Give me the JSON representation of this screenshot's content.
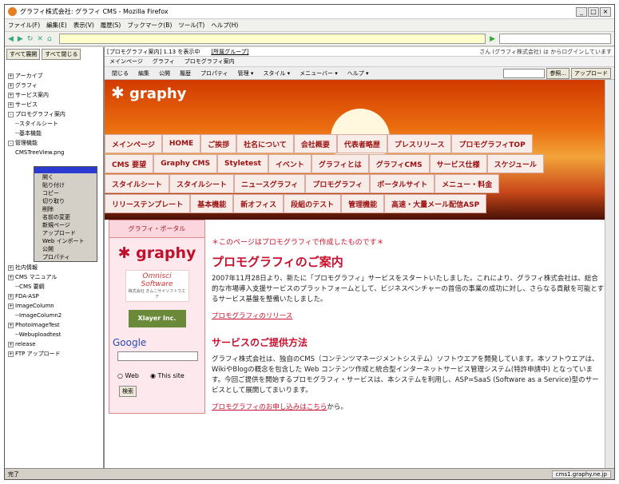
{
  "window": {
    "title": "グラフィ株式会社: グラフィ CMS - Mozilla Firefox"
  },
  "menu": [
    "ファイル(F)",
    "編集(E)",
    "表示(V)",
    "履歴(S)",
    "ブックマーク(B)",
    "ツール(T)",
    "ヘルプ(H)"
  ],
  "left": {
    "open_all": "すべて展開",
    "close_all": "すべて閉じる",
    "tree": [
      {
        "t": "アーカイブ",
        "pm": "+"
      },
      {
        "t": "グラフィ",
        "pm": "+"
      },
      {
        "t": "サービス案内",
        "pm": "+"
      },
      {
        "t": "サービス",
        "pm": "+"
      },
      {
        "t": "プロモグラフィ案内",
        "pm": "-"
      },
      {
        "t": "--スタイルシート",
        "pm": ""
      },
      {
        "t": "--基本機能",
        "pm": ""
      },
      {
        "t": "管理機能",
        "pm": "-"
      },
      {
        "t": "CMSTreeView.png",
        "pm": ""
      }
    ],
    "tree_after": [
      {
        "t": "社内情報",
        "pm": "+"
      },
      {
        "t": "CMS マニュアル",
        "pm": "+"
      },
      {
        "t": "--CMS 要綱",
        "pm": ""
      },
      {
        "t": "FDA-ASP",
        "pm": "+"
      },
      {
        "t": "ImageColumn",
        "pm": "+"
      },
      {
        "t": "--ImageColumn2",
        "pm": ""
      },
      {
        "t": "PhotoImageTest",
        "pm": "+"
      },
      {
        "t": "--Webuploadtest",
        "pm": ""
      },
      {
        "t": "release",
        "pm": "+"
      },
      {
        "t": "FTP アップロード",
        "pm": "+"
      }
    ],
    "ctx": [
      "開く",
      "貼り付け",
      "コピー",
      "切り取り",
      "削除",
      "名前の変更",
      "新規ページ",
      "アップロード",
      "Web インポート",
      "公開",
      "プロパティ"
    ]
  },
  "info": {
    "path": "[プロモグラフィ案内] 1.13 を表示中",
    "group": "[所属グループ]",
    "login": "さん (グラフィ株式会社) は からログインしています"
  },
  "tabs": [
    "メインページ",
    "グラフィ",
    "プロモグラフィ案内"
  ],
  "toolbar": [
    "閉じる",
    "編集",
    "公開",
    "履歴",
    "プロパティ",
    "管理 ▾",
    "スタイル ▾",
    "メニューバー ▾",
    "ヘルプ ▾"
  ],
  "toolbar_r": {
    "ref": "参照...",
    "upload": "アップロード"
  },
  "banner_logo": "graphy",
  "nav": [
    [
      "メインページ",
      "HOME",
      "ご挨拶",
      "社名について",
      "会社概要",
      "代表者略歴",
      "プレスリリース",
      "プロモグラフィTOP"
    ],
    [
      "CMS 要望",
      "Graphy CMS",
      "Styletest",
      "イベント",
      "グラフィとは",
      "グラフィCMS",
      "サービス仕様",
      "スケジュール"
    ],
    [
      "スタイルシート",
      "スタイルシート",
      "ニュースグラフィ",
      "プロモグラフィ",
      "ポータルサイト",
      "メニュー・料金"
    ],
    [
      "リリーステンプレート",
      "基本機能",
      "新オフィス",
      "段組のテスト",
      "管理機能",
      "高速・大量メール配信ASP"
    ]
  ],
  "side": {
    "header": "グラフィ・ポータル",
    "logo": "graphy",
    "omni": "Omnisci Software",
    "omni_sub": "株式会社 オムニサイソフトウエア",
    "xl": "Xlayer Inc.",
    "google": "Google",
    "web": "Web",
    "site": "This site",
    "search": "検索"
  },
  "main": {
    "note": "＊このページはプロモグラフィで作成したものです＊",
    "h1": "プロモグラフィのご案内",
    "p1": "2007年11月28日より、新たに「プロモグラフィ」サービスをスタートいたしました。これにより、グラフィ株式会社は、総合的な市場導入支援サービスのプラットフォームとして、ビジネスベンチャーの首倍の事業の成功に対し、さらなる貢献を可能とするサービス基盤を整備いたしました。",
    "link1": "プロモグラフィのリリース",
    "h2": "サービスのご提供方法",
    "p2": "グラフィ株式会社は、独自のCMS（コンテンツマネージメントシステム）ソフトウエアを開発しています。本ソフトウエアは、WikiやBlogの概念を包含した Web コンテンツ作成と統合型インターネットサービス管理システム(特許申請中) となっています。今回ご提供を開始するプロモグラフィ・サービスは、本システムを利用し、ASP=SaaS (Software as a Service)型のサービスとして展開してまいります。",
    "link2": "プロモグラフィのお申し込みはこちら",
    "link2_tail": "から。"
  },
  "status": {
    "left": "完了",
    "domain": "cms1.graphy.ne.jp"
  }
}
